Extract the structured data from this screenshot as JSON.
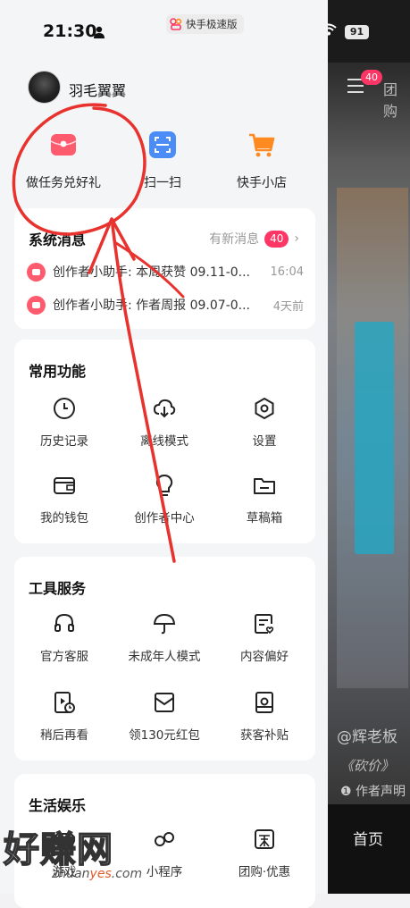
{
  "status_bar": {
    "time": "21:30",
    "app_pill": "快手极速版",
    "battery": "91"
  },
  "profile": {
    "username": "羽毛翼翼"
  },
  "shortcuts": [
    {
      "label": "做任务兑好礼",
      "icon": "red-packet-icon"
    },
    {
      "label": "扫一扫",
      "icon": "scan-icon"
    },
    {
      "label": "快手小店",
      "icon": "shopping-cart-icon"
    }
  ],
  "messages": {
    "title": "系统消息",
    "new_label": "有新消息",
    "badge": "40",
    "items": [
      {
        "text": "创作者小助手: 本周获赞 09.11-0...",
        "time": "16:04"
      },
      {
        "text": "创作者小助手: 作者周报 09.07-0...",
        "time": "4天前"
      }
    ]
  },
  "common": {
    "title": "常用功能",
    "items": [
      {
        "label": "历史记录",
        "icon": "clock-icon"
      },
      {
        "label": "离线模式",
        "icon": "cloud-download-icon"
      },
      {
        "label": "设置",
        "icon": "settings-icon"
      },
      {
        "label": "我的钱包",
        "icon": "wallet-icon"
      },
      {
        "label": "创作者中心",
        "icon": "lightbulb-icon"
      },
      {
        "label": "草稿箱",
        "icon": "folder-icon"
      }
    ]
  },
  "tools": {
    "title": "工具服务",
    "items": [
      {
        "label": "官方客服",
        "icon": "headset-icon"
      },
      {
        "label": "未成年人模式",
        "icon": "umbrella-icon"
      },
      {
        "label": "内容偏好",
        "icon": "preference-icon"
      },
      {
        "label": "稍后再看",
        "icon": "watch-later-icon"
      },
      {
        "label": "领130元红包",
        "icon": "red-envelope-icon"
      },
      {
        "label": "获客补贴",
        "icon": "subsidy-icon"
      }
    ]
  },
  "life": {
    "title": "生活娱乐",
    "items": [
      {
        "label": "游戏",
        "icon": "gamepad-icon"
      },
      {
        "label": "小程序",
        "icon": "mini-program-icon"
      },
      {
        "label": "团购·优惠",
        "icon": "group-buy-icon"
      }
    ]
  },
  "background_video": {
    "menu_badge": "40",
    "tab": "团购",
    "handle": "@辉老板",
    "song": "《砍价》",
    "author_note": "作者声明",
    "home_tab": "首页"
  },
  "watermark": {
    "brand": "好赚网",
    "url_prefix": "zhuan",
    "url_mid": "yes",
    "url_suffix": ".com"
  },
  "colors": {
    "accent": "#fe3666",
    "annotation": "#e8322e",
    "scan_blue": "#4b8cf6",
    "shop_orange": "#ff8a1f"
  }
}
